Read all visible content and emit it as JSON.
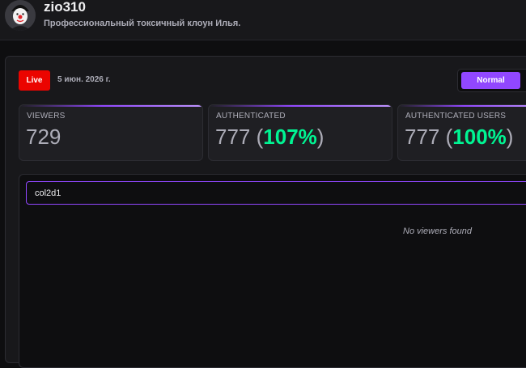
{
  "channel": {
    "name": "zio310",
    "description": "Профессиональный токсичный клоун Илья."
  },
  "stream": {
    "status": "Live",
    "date": "5 июн. 2026 г.",
    "mode": "Normal"
  },
  "stats": [
    {
      "label": "VIEWERS",
      "value": "729",
      "paren_open": "",
      "percent": "",
      "paren_close": ""
    },
    {
      "label": "AUTHENTICATED",
      "value": "777 ",
      "paren_open": "(",
      "percent": "107%",
      "paren_close": ")"
    },
    {
      "label": "AUTHENTICATED USERS",
      "value": "777 ",
      "paren_open": "(",
      "percent": "100%",
      "paren_close": ")"
    }
  ],
  "viewers": {
    "search_value": "col2d1",
    "empty_message": "No viewers found"
  },
  "colors": {
    "accent": "#9147ff",
    "live": "#eb0400",
    "positive": "#00f593"
  }
}
